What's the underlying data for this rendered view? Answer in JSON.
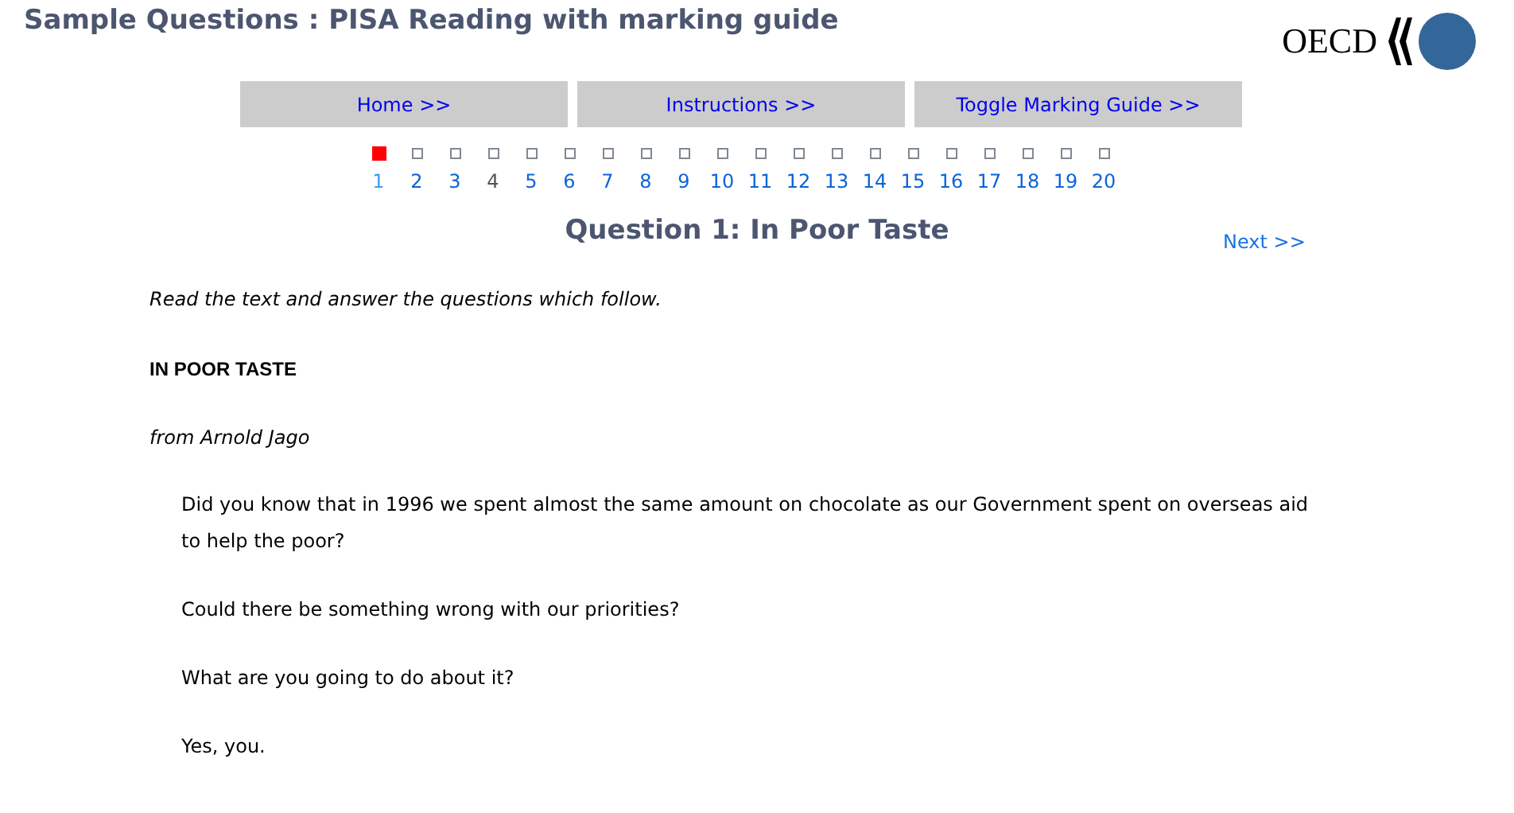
{
  "header": {
    "title": "Sample Questions : PISA Reading with marking guide",
    "logo_text": "OECD"
  },
  "nav_buttons": [
    "Home >>",
    "Instructions >>",
    "Toggle Marking Guide >>"
  ],
  "pager": [
    {
      "label": "1",
      "selected": true,
      "visited": false
    },
    {
      "label": "2",
      "selected": false,
      "visited": false
    },
    {
      "label": "3",
      "selected": false,
      "visited": false
    },
    {
      "label": "4",
      "selected": false,
      "visited": true
    },
    {
      "label": "5",
      "selected": false,
      "visited": false
    },
    {
      "label": "6",
      "selected": false,
      "visited": false
    },
    {
      "label": "7",
      "selected": false,
      "visited": false
    },
    {
      "label": "8",
      "selected": false,
      "visited": false
    },
    {
      "label": "9",
      "selected": false,
      "visited": false
    },
    {
      "label": "10",
      "selected": false,
      "visited": false
    },
    {
      "label": "11",
      "selected": false,
      "visited": false
    },
    {
      "label": "12",
      "selected": false,
      "visited": false
    },
    {
      "label": "13",
      "selected": false,
      "visited": false
    },
    {
      "label": "14",
      "selected": false,
      "visited": false
    },
    {
      "label": "15",
      "selected": false,
      "visited": false
    },
    {
      "label": "16",
      "selected": false,
      "visited": false
    },
    {
      "label": "17",
      "selected": false,
      "visited": false
    },
    {
      "label": "18",
      "selected": false,
      "visited": false
    },
    {
      "label": "19",
      "selected": false,
      "visited": false
    },
    {
      "label": "20",
      "selected": false,
      "visited": false
    }
  ],
  "question_title": "Question 1: In Poor Taste",
  "next_link": "Next >>",
  "content": [
    {
      "kind": "instruction",
      "text": "Read the text and answer the questions which follow."
    },
    {
      "kind": "heading",
      "text": "IN POOR TASTE"
    },
    {
      "kind": "byline",
      "text": "from Arnold Jago"
    },
    {
      "kind": "body",
      "text": "Did you know that in 1996 we spent almost the same amount on chocolate as our Government spent on overseas aid to help the poor?"
    },
    {
      "kind": "body",
      "text": "Could there be something wrong with our priorities?"
    },
    {
      "kind": "body",
      "text": "What are you going to do about it?"
    },
    {
      "kind": "body",
      "text": "Yes, you."
    }
  ]
}
